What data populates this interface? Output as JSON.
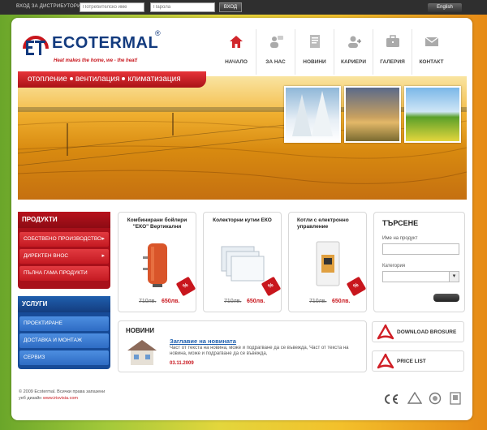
{
  "topbar": {
    "login_label": "ВХОД ЗА ДИСТРИБУТОРИ",
    "username_placeholder": "Потребителско име",
    "password_placeholder": "Парола",
    "login_button": "ВХОД",
    "language_button": "English"
  },
  "logo": {
    "title": "ECOTERMAL",
    "registered": "®",
    "tagline": "Heat makes the home, we - the heat!"
  },
  "nav": {
    "items": [
      {
        "label": "НАЧАЛО",
        "icon": "home-icon"
      },
      {
        "label": "ЗА НАС",
        "icon": "people-icon"
      },
      {
        "label": "НОВИНИ",
        "icon": "news-icon"
      },
      {
        "label": "КАРИЕРИ",
        "icon": "career-icon"
      },
      {
        "label": "ГАЛЕРИЯ",
        "icon": "briefcase-icon"
      },
      {
        "label": "КОНТАКТ",
        "icon": "mail-icon"
      }
    ]
  },
  "hero": {
    "band_items": [
      "отопление",
      "вентилация",
      "климатизация"
    ]
  },
  "products_menu": {
    "title": "ПРОДУКТИ",
    "items": [
      {
        "label": "СОБСТВЕНО ПРОИЗВОДСТВО",
        "arrow": "▸"
      },
      {
        "label": "ДИРЕКТЕН ВНОС",
        "arrow": "▸"
      },
      {
        "label": "ПЪЛНА ГАМА ПРОДУКТИ",
        "arrow": ""
      }
    ]
  },
  "services_menu": {
    "title": "УСЛУГИ",
    "items": [
      {
        "label": "ПРОЕКТИРАНЕ"
      },
      {
        "label": "ДОСТАВКА И МОНТАЖ"
      },
      {
        "label": "СЕРВИЗ"
      }
    ]
  },
  "products": [
    {
      "title_line1": "Комбинирани бойлери",
      "title_line2": "\"ЕКО\" Вертикални",
      "old_price": "710лв.",
      "new_price": "650лв.",
      "badge": "%"
    },
    {
      "title_line1": "Колекторни кутии ЕКО",
      "title_line2": "",
      "old_price": "710лв.",
      "new_price": "650лв.",
      "badge": "%"
    },
    {
      "title_line1": "Котли с електронно",
      "title_line2": "управление",
      "old_price": "710лв.",
      "new_price": "650лв.",
      "badge": "%"
    }
  ],
  "search": {
    "title": "ТЪРСЕНЕ",
    "product_name_label": "Име на продукт",
    "category_label": "Категория"
  },
  "news": {
    "heading": "НОВИНИ",
    "title": "Заглавие на новината",
    "body": "Част от текста на новина, може и подрагване да се въвежда, Част от текста на новина, може и подрагване да се въвежда,",
    "date": "03.11.2009"
  },
  "downloads": [
    {
      "label": "DOWNLOAD BROSURE"
    },
    {
      "label": "PRICE LIST"
    }
  ],
  "footer": {
    "copyright": "© 2009 Ecotermal. Всички права запазени",
    "design_label": "уеб дизайн",
    "design_link": "www.irisvisia.com"
  },
  "colors": {
    "brand_red": "#c8161d",
    "brand_blue": "#123a7e",
    "services_blue": "#1f5fae"
  }
}
